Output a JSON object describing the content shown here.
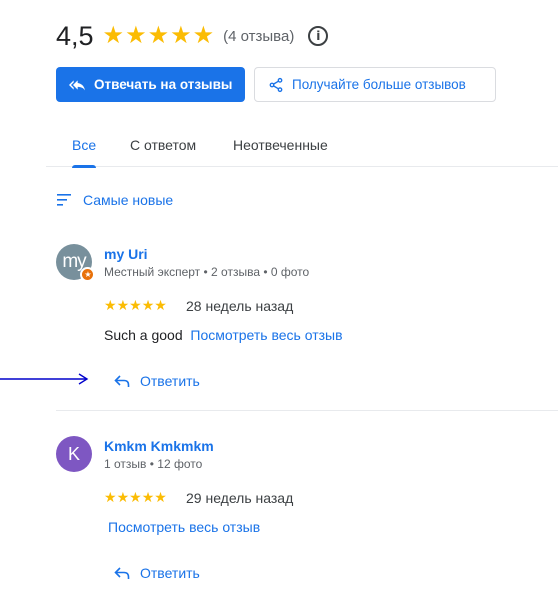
{
  "summary": {
    "score": "4,5",
    "stars": 5,
    "review_count": "(4 отзыва)",
    "info_icon": "info-icon"
  },
  "actions": {
    "reply_reviews_label": "Отвечать на отзывы",
    "get_more_reviews_label": "Получайте больше отзывов"
  },
  "tabs": [
    {
      "label": "Все",
      "active": true
    },
    {
      "label": "С ответом",
      "active": false
    },
    {
      "label": "Неотвеченные",
      "active": false
    }
  ],
  "sort": {
    "label": "Самые новые"
  },
  "reviews": [
    {
      "avatar_text": "my",
      "author": "my Uri",
      "meta": "Местный эксперт • 2 отзыва • 0 фото",
      "rating": 5,
      "date": "28 недель назад",
      "text": "Such a good",
      "read_more": "Посмотреть весь отзыв",
      "reply_label": "Ответить"
    },
    {
      "avatar_text": "K",
      "author": "Kmkm Kmkmkm",
      "meta": "1 отзыв • 12 фото",
      "rating": 5,
      "date": "29 недель назад",
      "text": "",
      "read_more": "Посмотреть весь отзыв",
      "reply_label": "Ответить"
    }
  ],
  "colors": {
    "accent": "#1a73e8",
    "star": "#fbbc04",
    "avatar_1": "#78909c",
    "avatar_2": "#7e57c2",
    "badge": "#e8710a",
    "annotation_arrow": "#0000cc"
  }
}
